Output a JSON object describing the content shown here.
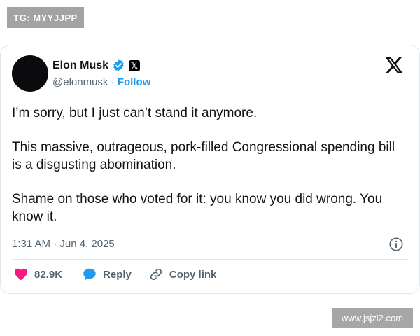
{
  "watermarks": {
    "top": "TG: MYYJJPP",
    "bottom": "www.jsjzl2.com"
  },
  "tweet": {
    "author": {
      "name": "Elon Musk",
      "handle": "@elonmusk",
      "separator": "·",
      "follow_label": "Follow"
    },
    "x_badge_glyph": "𝕏",
    "paragraphs": [
      "I’m sorry, but I just can’t stand it anymore.",
      "This massive, outrageous, pork-filled Congressional spending bill is a disgusting abomination.",
      "Shame on those who voted for it: you know you did wrong. You know it."
    ],
    "timestamp": "1:31 AM · Jun 4, 2025",
    "actions": {
      "like_count": "82.9K",
      "reply_label": "Reply",
      "copy_link_label": "Copy link"
    }
  },
  "icons": {
    "verified": "verified-badge-icon",
    "x_logo": "x-logo-icon",
    "info": "info-icon",
    "like": "heart-icon",
    "reply": "speech-bubble-icon",
    "copy_link": "link-icon"
  },
  "colors": {
    "accent": "#1d9bf0",
    "like": "#f91880",
    "text": "#0f1419",
    "secondary": "#536471"
  }
}
